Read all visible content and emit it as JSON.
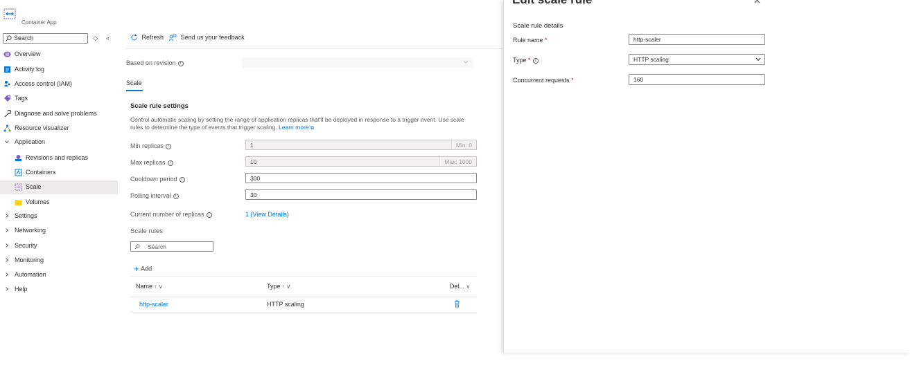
{
  "sidebar": {
    "app_subtitle": "Container App",
    "search_placeholder": "Search",
    "items": [
      {
        "label": "Overview"
      },
      {
        "label": "Activity log"
      },
      {
        "label": "Access control (IAM)"
      },
      {
        "label": "Tags"
      },
      {
        "label": "Diagnose and solve problems"
      },
      {
        "label": "Resource visualizer"
      },
      {
        "label": "Application"
      },
      {
        "label": "Revisions and replicas"
      },
      {
        "label": "Containers"
      },
      {
        "label": "Scale"
      },
      {
        "label": "Volumes"
      },
      {
        "label": "Settings"
      },
      {
        "label": "Networking"
      },
      {
        "label": "Security"
      },
      {
        "label": "Monitoring"
      },
      {
        "label": "Automation"
      },
      {
        "label": "Help"
      }
    ]
  },
  "toolbar": {
    "refresh_label": "Refresh",
    "feedback_label": "Send us your feedback"
  },
  "main": {
    "based_on_revision_label": "Based on revision",
    "tab_scale": "Scale",
    "scale_rule_settings_title": "Scale rule settings",
    "description": "Control automatic scaling by setting the range of application replicas that'll be deployed in response to a trigger event. Use scale rules to determine the type of events that trigger scaling.",
    "learn_more": "Learn more",
    "min_replicas_label": "Min replicas",
    "min_replicas_value": "1",
    "min_replicas_suffix": "Min: 0",
    "max_replicas_label": "Max replicas",
    "max_replicas_value": "10",
    "max_replicas_suffix": "Max: 1000",
    "cooldown_label": "Cooldown period",
    "cooldown_value": "300",
    "polling_label": "Polling interval",
    "polling_value": "30",
    "current_replicas_label": "Current number of replicas",
    "current_replicas_value": "1",
    "view_details": "(View Details)",
    "scale_rules_title": "Scale rules",
    "rules_search_placeholder": "Search",
    "add_label": "Add",
    "table": {
      "columns": [
        "Name",
        "Type",
        "Del..."
      ],
      "rows": [
        {
          "name": "http-scaler",
          "type": "HTTP scaling"
        }
      ]
    }
  },
  "panel": {
    "title": "Edit scale rule",
    "section_title": "Scale rule details",
    "rule_name_label": "Rule name",
    "rule_name_value": "http-scaler",
    "type_label": "Type",
    "type_value": "HTTP scaling",
    "concurrent_label": "Concurrent requests",
    "concurrent_value": "160"
  },
  "colors": {
    "accent": "#0078d4",
    "selected_bg": "#edebe9",
    "required": "#a4262c"
  }
}
